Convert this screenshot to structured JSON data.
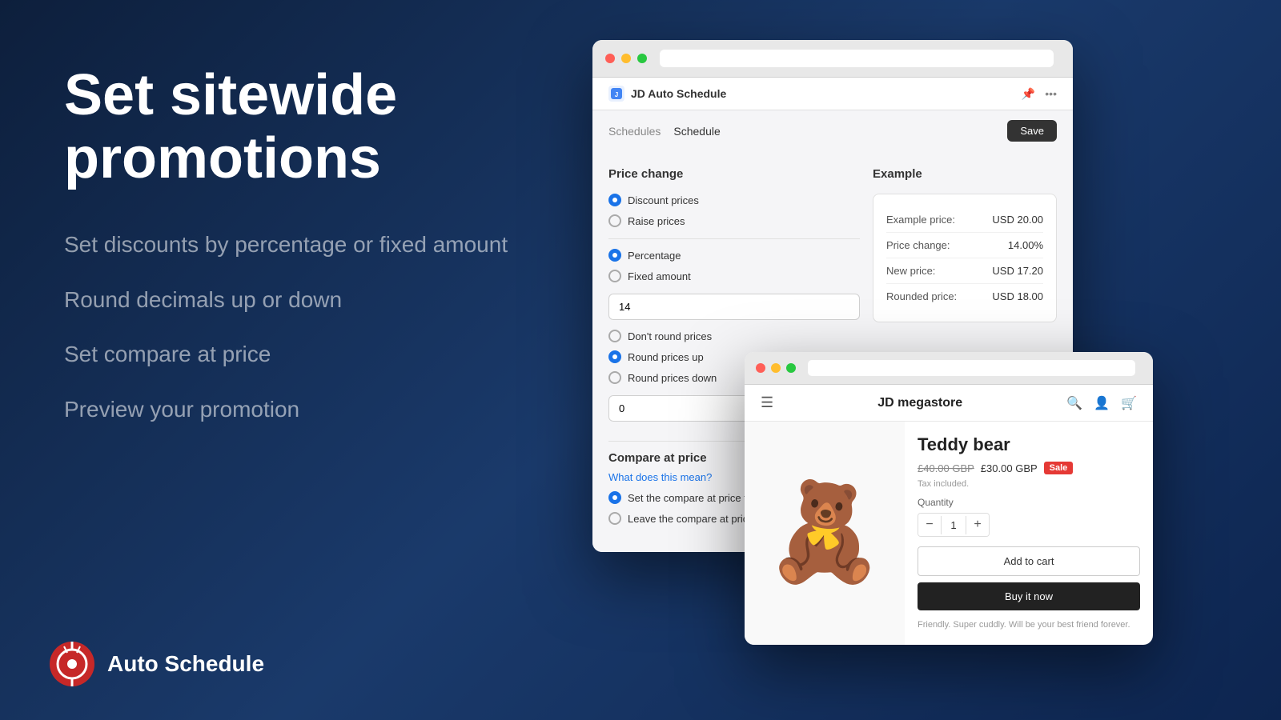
{
  "background": {
    "color": "#0d1f3c"
  },
  "left": {
    "heading": "Set sitewide promotions",
    "features": [
      "Set discounts by percentage or fixed amount",
      "Round decimals up or down",
      "Set compare at price",
      "Preview your promotion"
    ]
  },
  "logo": {
    "text": "Auto Schedule"
  },
  "main_window": {
    "title": "JD Auto Schedule",
    "nav": {
      "schedules": "Schedules",
      "schedule": "Schedule",
      "save": "Save"
    },
    "price_change": {
      "section_title": "Price change",
      "options": [
        {
          "label": "Discount prices",
          "checked": true
        },
        {
          "label": "Raise prices",
          "checked": false
        }
      ],
      "type_options": [
        {
          "label": "Percentage",
          "checked": true
        },
        {
          "label": "Fixed amount",
          "checked": false
        }
      ],
      "input_value": "14",
      "rounding_options": [
        {
          "label": "Don't round prices",
          "checked": false
        },
        {
          "label": "Round prices up",
          "checked": true
        },
        {
          "label": "Round prices down",
          "checked": false
        }
      ],
      "rounding_input": "0"
    },
    "compare": {
      "section_title": "Compare at price",
      "what_link": "What does this mean?",
      "options": [
        {
          "label": "Set the compare at price to",
          "checked": true
        },
        {
          "label": "Leave the compare at price",
          "checked": false
        }
      ]
    },
    "example": {
      "title": "Example",
      "rows": [
        {
          "label": "Example price:",
          "value": "USD 20.00"
        },
        {
          "label": "Price change:",
          "value": "14.00%"
        },
        {
          "label": "New price:",
          "value": "USD 17.20"
        },
        {
          "label": "Rounded price:",
          "value": "USD 18.00"
        }
      ]
    }
  },
  "store_window": {
    "store_name": "JD megastore",
    "product": {
      "name": "Teddy bear",
      "price_original": "£40.00 GBP",
      "price_current": "£30.00 GBP",
      "sale_badge": "Sale",
      "tax_text": "Tax included.",
      "quantity_label": "Quantity",
      "quantity_value": "1",
      "add_to_cart": "Add to cart",
      "buy_now": "Buy it now",
      "description": "Friendly. Super cuddly. Will be your best friend forever."
    }
  }
}
